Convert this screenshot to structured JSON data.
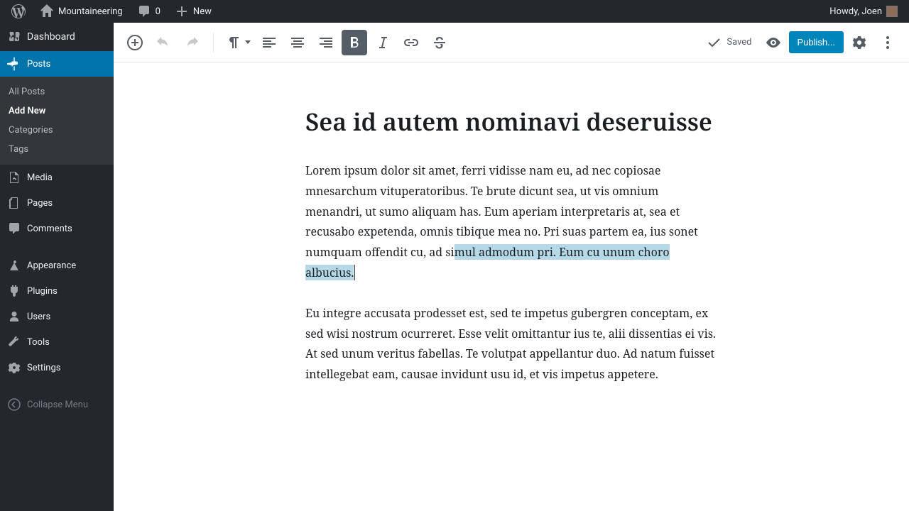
{
  "adminbar": {
    "site_name": "Mountaineering",
    "comments_count": "0",
    "new_label": "New",
    "howdy": "Howdy, Joen"
  },
  "sidebar": {
    "dashboard": "Dashboard",
    "posts": "Posts",
    "submenu": {
      "all_posts": "All Posts",
      "add_new": "Add New",
      "categories": "Categories",
      "tags": "Tags"
    },
    "media": "Media",
    "pages": "Pages",
    "comments": "Comments",
    "appearance": "Appearance",
    "plugins": "Plugins",
    "users": "Users",
    "tools": "Tools",
    "settings": "Settings",
    "collapse": "Collapse Menu"
  },
  "toolbar": {
    "saved": "Saved",
    "publish": "Publish..."
  },
  "post": {
    "title": "Sea id autem nominavi deseruisse",
    "p1_before": "Lorem ipsum dolor sit amet, ferri vidisse nam eu, ad nec copiosae mnesarchum vituperatoribus. Te brute dicunt sea, ut vis omnium menandri, ut sumo aliquam has. Eum aperiam interpretaris at, sea et recusabo expetenda, omnis tibique mea no. Pri suas partem ea, ius sonet numquam offendit cu, ad si",
    "p1_highlight": "mul admodum pri. Eum cu unum choro albucius. ",
    "p2": "Eu integre accusata prodesset est, sed te impetus gubergren conceptam, ex sed wisi nostrum ocurreret. Esse velit omittantur ius te, alii dissentias ei vis. At sed unum veritus fabellas. Te volutpat appellantur duo. Ad natum fuisset intellegebat eam, causae invidunt usu id, et vis impetus appetere."
  }
}
